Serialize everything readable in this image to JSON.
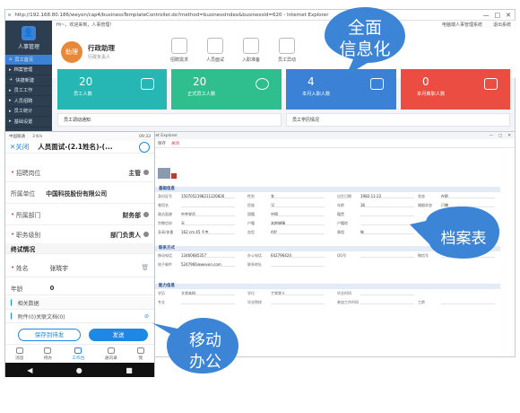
{
  "desktop": {
    "url_title": "http://192.168.80.186/weyon/cap4/businessTemplateController.do?method=businessIndex&businessId=620 - Internet Explorer",
    "greeting": "Hi~，欢迎来到，人事管理！",
    "top_links": [
      "电脑端人事管理系统",
      "退出系统"
    ],
    "logo_label": "人事管理",
    "menu": [
      "员工首页",
      "档案管理",
      "快捷新建",
      "员工工作",
      "人员招聘",
      "员工统计",
      "基础设置"
    ],
    "profile": {
      "avatar": "助理",
      "name": "行政助理",
      "sub": "行政负责人"
    },
    "quick_actions": [
      "招聘需求",
      "人员面试",
      "入职准备",
      "员工异动"
    ],
    "cards": [
      {
        "num": "20",
        "label": "员工人数",
        "color": "#26b6b4"
      },
      {
        "num": "20",
        "label": "正式员工人数",
        "color": "#2fbf8e"
      },
      {
        "num": "4",
        "label": "本月入职人数",
        "color": "#3b82d6"
      },
      {
        "num": "0",
        "label": "本月离职人数",
        "color": "#ec4d42"
      }
    ],
    "bottom_panels": [
      "员工调动通知",
      "员工学历情况"
    ]
  },
  "form_window": {
    "title": "新员工入职 - Internet Explorer",
    "toolbar": [
      "保存",
      "关闭"
    ],
    "sections": [
      "基础信息",
      "联系方式",
      "能力信息"
    ],
    "fields_row1": [
      [
        "身份证号",
        "1507052198211220826"
      ],
      [
        "性别",
        "女"
      ],
      [
        "出生日期",
        "1982-11-22"
      ],
      [
        "状态",
        "在职"
      ]
    ],
    "fields_row2": [
      [
        "曾用名",
        ""
      ],
      [
        "民族",
        "汉"
      ],
      [
        "年龄",
        "36"
      ],
      [
        "婚姻状态",
        "已婚"
      ]
    ],
    "fields_row3": [
      [
        "政治面貌",
        "中共党员"
      ],
      [
        "国籍",
        "中国"
      ],
      [
        "籍贯",
        ""
      ],
      [
        "",
        ""
      ]
    ],
    "fields_row4": [
      [
        "宗教信仰",
        "无"
      ],
      [
        "户籍",
        "本地城镇"
      ],
      [
        "户籍地",
        ""
      ],
      [
        "",
        ""
      ]
    ],
    "fields_row5": [
      [
        "身高/体重",
        "162  cm  45  千克"
      ],
      [
        "血型",
        "A型"
      ],
      [
        "属相",
        "狗"
      ],
      [
        "星座",
        "射手座"
      ]
    ],
    "contact_row1": [
      [
        "移动电话",
        "13460685357"
      ],
      [
        "办公电话",
        "642796424"
      ],
      [
        "QQ号",
        ""
      ],
      [
        "微信号",
        ""
      ]
    ],
    "contact_row2": [
      [
        "电子邮件",
        "5247966@weyon.com"
      ],
      [
        "联系地址",
        ""
      ],
      [
        "",
        ""
      ],
      [
        "",
        ""
      ]
    ],
    "ability_row1": [
      [
        "学历",
        "大学本科"
      ],
      [
        "学位",
        "工学学士"
      ],
      [
        "毕业时间",
        ""
      ],
      [
        "",
        ""
      ]
    ],
    "ability_row2": [
      [
        "专业",
        ""
      ],
      [
        "毕业院校",
        ""
      ],
      [
        "参加工作时间",
        ""
      ],
      [
        "工龄",
        ""
      ]
    ]
  },
  "phone": {
    "status_left": "中国联通",
    "status_mid": "3 K/s",
    "status_right": "09:33",
    "close_label": "✕关闭",
    "title": "人员面试-(2.1姓名)-(...",
    "rows": [
      {
        "label": "招聘岗位",
        "value": "主管",
        "req": true
      },
      {
        "label": "所属单位",
        "value": "中国科技股份有限公司",
        "req": false
      },
      {
        "label": "所属部门",
        "value": "财务部",
        "req": true
      },
      {
        "label": "职务级别",
        "value": "部门负责人",
        "req": true
      }
    ],
    "section_label": "终试情况",
    "name_label": "姓名",
    "name_value": "张晓宇",
    "age_label": "年龄",
    "age_value": "0",
    "related": "相关数据",
    "attach": "附件(0)关联文档(0)",
    "save_btn": "保存到待发",
    "send_btn": "发送",
    "tabs": [
      "消息",
      "待办",
      "工作台",
      "通讯录",
      "我"
    ],
    "active_tab": "工作台"
  },
  "callouts": {
    "c1": [
      "全面",
      "信息化"
    ],
    "c2": "档案表",
    "c3": [
      "移动",
      "办公"
    ],
    "color": "#3b84d6"
  }
}
